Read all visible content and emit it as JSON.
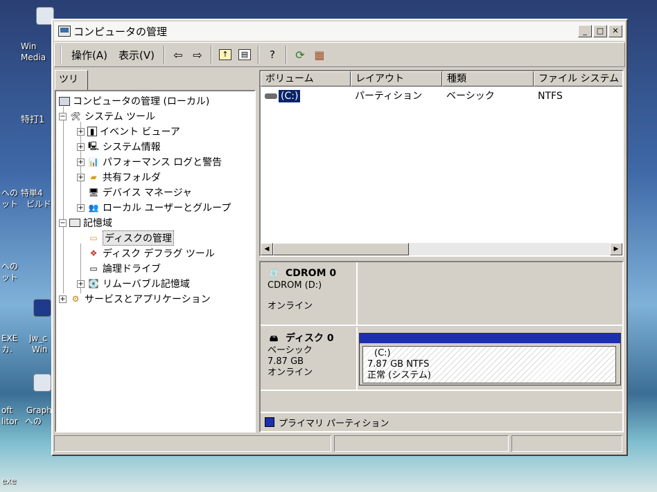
{
  "window": {
    "title": "コンピュータの管理"
  },
  "menu": {
    "action": "操作(A)",
    "view": "表示(V)"
  },
  "toolbar": {
    "back": "⇦",
    "forward": "⇨"
  },
  "tree": {
    "tab": "ツリー",
    "items": [
      "コンピュータの管理 (ローカル)",
      "システム ツール",
      "イベント ビューア",
      "システム情報",
      "パフォーマンス ログと警告",
      "共有フォルダ",
      "デバイス マネージャ",
      "ローカル ユーザーとグループ",
      "記憶域",
      "ディスクの管理",
      "ディスク デフラグ ツール",
      "論理ドライブ",
      "リムーバブル記憶域",
      "サービスとアプリケーション"
    ]
  },
  "list": {
    "columns": [
      "ボリューム",
      "レイアウト",
      "種類",
      "ファイル システム"
    ],
    "rows": [
      {
        "volume": "(C:)",
        "layout": "パーティション",
        "type": "ベーシック",
        "fs": "NTFS"
      }
    ]
  },
  "disks": {
    "cdrom": {
      "name": "CDROM 0",
      "type": "CDROM (D:)",
      "status": "オンライン"
    },
    "disk0": {
      "name": "ディスク 0",
      "type": "ベーシック",
      "size": "7.87 GB",
      "status": "オンライン",
      "partition": {
        "label": "(C:)",
        "size": "7.87 GB NTFS",
        "status": "正常 (システム)"
      }
    }
  },
  "legend": {
    "primary": "プライマリ パーティション"
  },
  "desktop": {
    "icons": [
      "Win",
      "Media",
      "特打1",
      "への",
      "ット",
      "特単4",
      "ビルド",
      "への",
      "ット",
      "EXE",
      "カ.",
      "Jw_c",
      "Win",
      "oft",
      "litor",
      "Graph",
      "への",
      "exe"
    ]
  },
  "colors": {
    "partition_blue": "#1c2fb0",
    "selection": "#0a246a"
  }
}
